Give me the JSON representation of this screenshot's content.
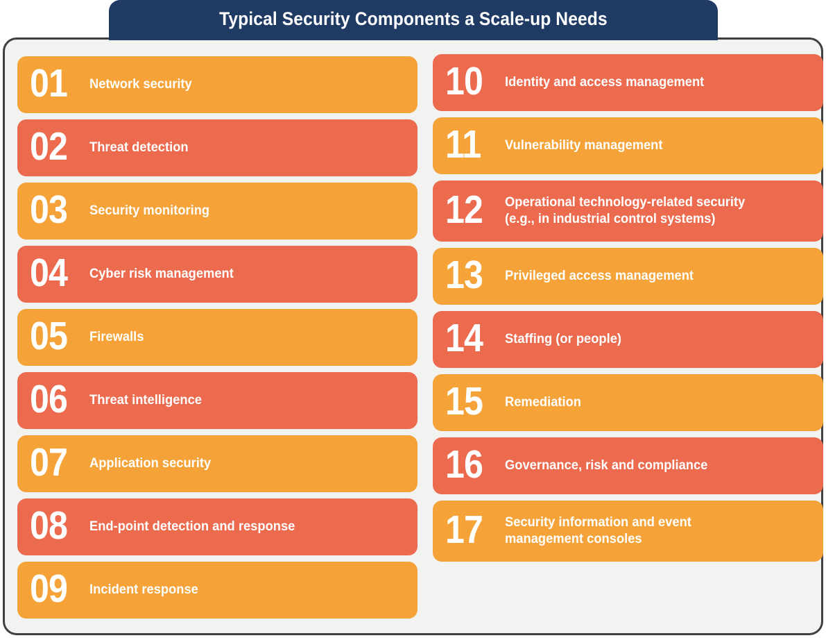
{
  "header": {
    "title": "Typical Security Components a Scale-up Needs"
  },
  "colors": {
    "orange": "#F5A338",
    "red": "#EC6A4D",
    "navy": "#1F3A63",
    "frame_border": "#3E4044",
    "frame_background": "#F2F2F0",
    "text": "#FFFFFF"
  },
  "columns": {
    "left": {
      "items": [
        {
          "number": "01",
          "label": "Network security",
          "color": "orange"
        },
        {
          "number": "02",
          "label": "Threat detection",
          "color": "red"
        },
        {
          "number": "03",
          "label": "Security monitoring",
          "color": "orange"
        },
        {
          "number": "04",
          "label": "Cyber risk management",
          "color": "red"
        },
        {
          "number": "05",
          "label": "Firewalls",
          "color": "orange"
        },
        {
          "number": "06",
          "label": "Threat intelligence",
          "color": "red"
        },
        {
          "number": "07",
          "label": "Application security",
          "color": "orange"
        },
        {
          "number": "08",
          "label": "End-point detection and response",
          "color": "red"
        },
        {
          "number": "09",
          "label": "Incident response",
          "color": "orange"
        }
      ]
    },
    "right": {
      "items": [
        {
          "number": "10",
          "label": "Identity and access management",
          "color": "red"
        },
        {
          "number": "11",
          "label": "Vulnerability management",
          "color": "orange"
        },
        {
          "number": "12",
          "label": "Operational technology-related security",
          "label_line2": "(e.g., in industrial control systems)",
          "color": "red"
        },
        {
          "number": "13",
          "label": "Privileged access management",
          "color": "orange"
        },
        {
          "number": "14",
          "label": "Staffing (or people)",
          "color": "red"
        },
        {
          "number": "15",
          "label": "Remediation",
          "color": "orange"
        },
        {
          "number": "16",
          "label": "Governance, risk and compliance",
          "color": "red"
        },
        {
          "number": "17",
          "label": "Security information and event",
          "label_line2": "management consoles",
          "color": "orange"
        }
      ]
    }
  }
}
